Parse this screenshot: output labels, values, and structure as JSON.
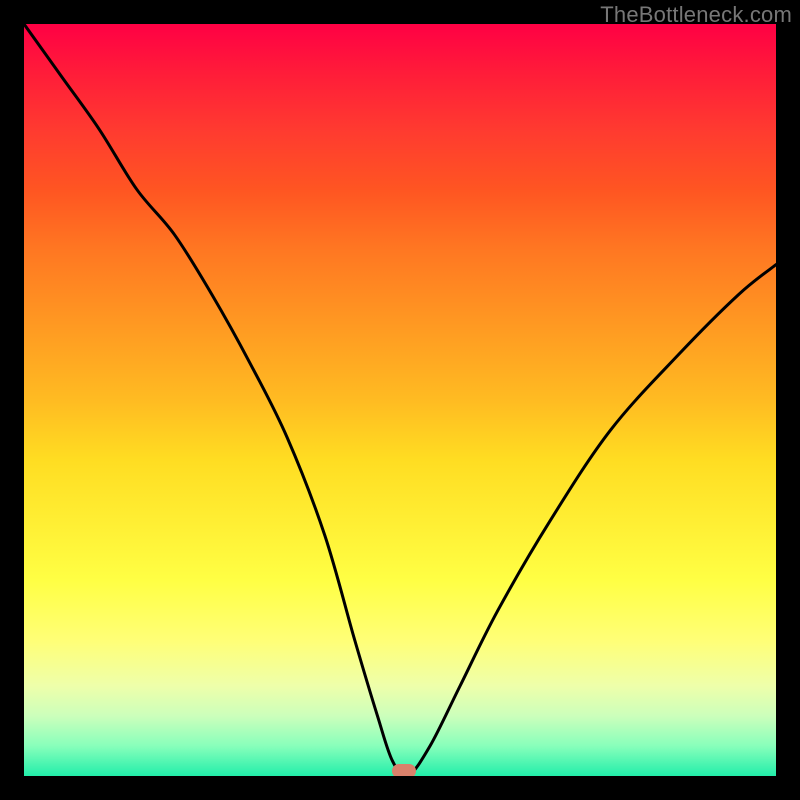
{
  "watermark": "TheBottleneck.com",
  "chart_data": {
    "type": "line",
    "title": "",
    "xlabel": "",
    "ylabel": "",
    "xlim": [
      0,
      100
    ],
    "ylim": [
      0,
      100
    ],
    "series": [
      {
        "name": "bottleneck-curve",
        "x": [
          0,
          5,
          10,
          15,
          20,
          25,
          30,
          35,
          40,
          44,
          47,
          49,
          51,
          54,
          58,
          63,
          70,
          78,
          87,
          95,
          100
        ],
        "values": [
          100,
          93,
          86,
          78,
          72,
          64,
          55,
          45,
          32,
          18,
          8,
          2,
          0,
          4,
          12,
          22,
          34,
          46,
          56,
          64,
          68
        ]
      }
    ],
    "marker": {
      "x": 50.5,
      "y": 0.7
    },
    "background_gradient": {
      "stops": [
        {
          "pos": 0,
          "color": "#ff0044"
        },
        {
          "pos": 50,
          "color": "#ffdd22"
        },
        {
          "pos": 100,
          "color": "#22eeaa"
        }
      ]
    }
  }
}
